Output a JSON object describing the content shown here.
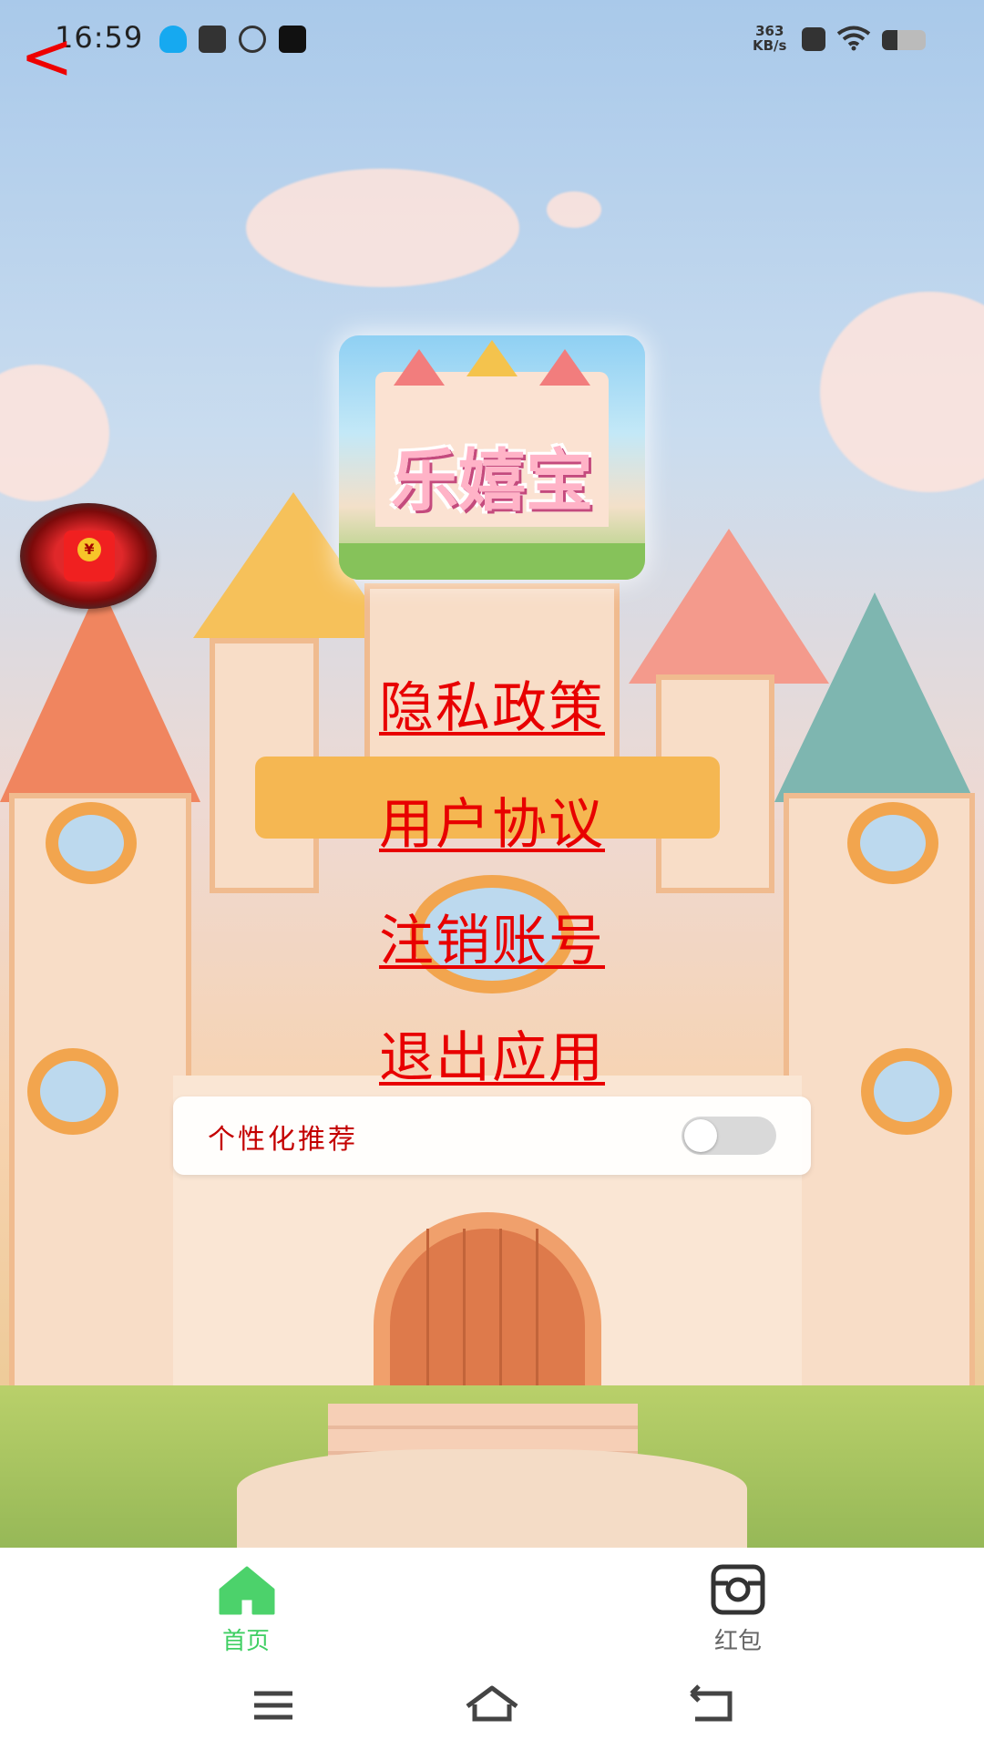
{
  "status_bar": {
    "time": "16:59",
    "net_speed_value": "363",
    "net_speed_unit": "KB/s",
    "battery_level": 0.35
  },
  "header": {
    "back_glyph": "<"
  },
  "logo": {
    "title": "乐嬉宝"
  },
  "links": {
    "privacy": "隐私政策",
    "user_agreement": "用户协议",
    "cancel_account": "注销账号",
    "exit_app": "退出应用"
  },
  "settings": {
    "personalized_label": "个性化推荐",
    "personalized_on": false
  },
  "redpack": {
    "coin_symbol": "¥"
  },
  "tabs": [
    {
      "label": "首页",
      "icon": "home-icon",
      "active": true
    },
    {
      "label": "红包",
      "icon": "camera-icon",
      "active": false
    }
  ],
  "colors": {
    "link": "#e80000",
    "tab_active": "#3fcf63",
    "tab_inactive": "#666666"
  }
}
